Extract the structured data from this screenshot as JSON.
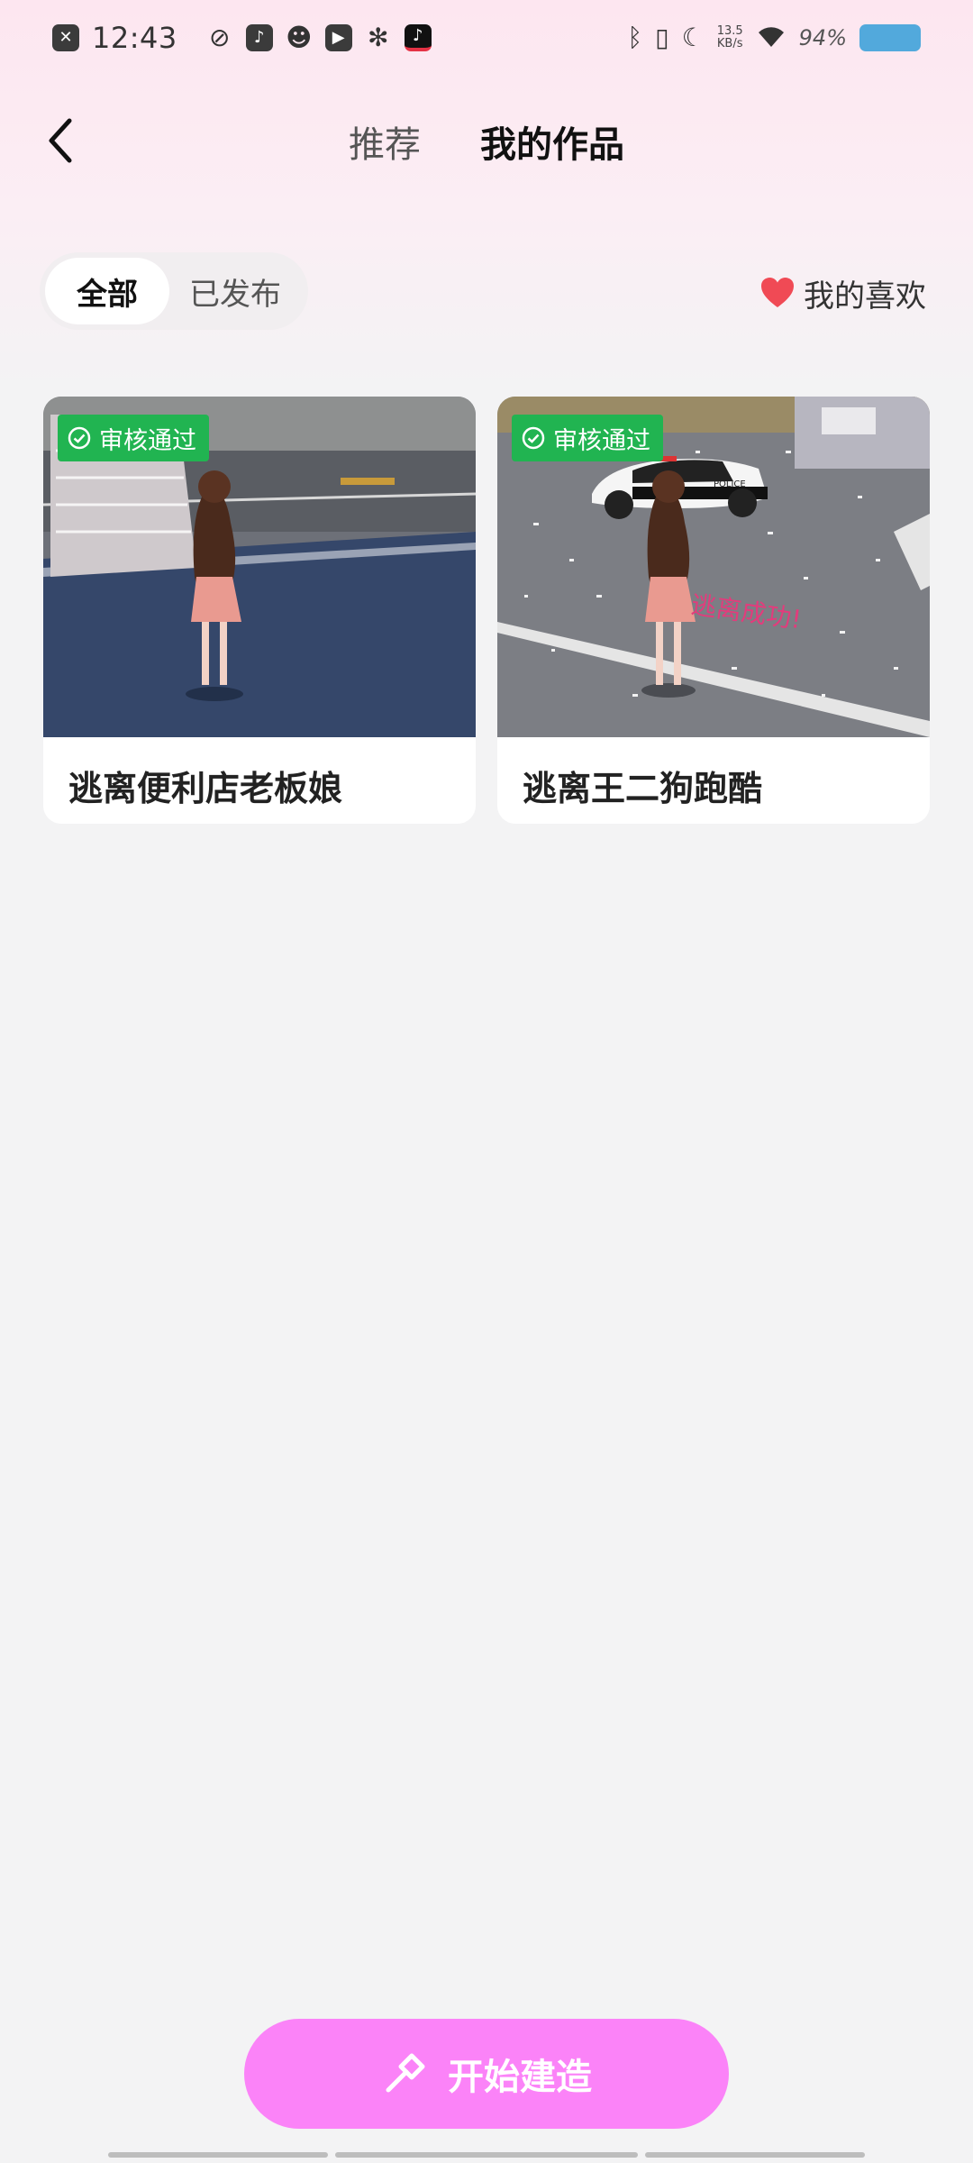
{
  "status_bar": {
    "time": "12:43",
    "net_speed_value": "13.5",
    "net_speed_unit": "KB/s",
    "battery_percent": "94%",
    "icons": [
      "close-square-icon",
      "app-icon",
      "music-icon",
      "cat-icon",
      "play-icon",
      "fan-icon",
      "tiktok-icon",
      "bluetooth-icon",
      "vibrate-icon",
      "moon-icon",
      "wifi-icon",
      "battery-icon"
    ]
  },
  "header": {
    "tabs": [
      {
        "label": "推荐",
        "active": false
      },
      {
        "label": "我的作品",
        "active": true
      }
    ]
  },
  "filters": {
    "options": [
      {
        "label": "全部",
        "active": true
      },
      {
        "label": "已发布",
        "active": false
      }
    ],
    "likes_label": "我的喜欢"
  },
  "works": [
    {
      "title": "逃离便利店老板娘",
      "badge": "审核通过"
    },
    {
      "title": "逃离王二狗跑酷",
      "badge": "审核通过",
      "overlay_text": "逃离成功!",
      "car_text": "POLICE"
    }
  ],
  "cta": {
    "label": "开始建造"
  },
  "colors": {
    "accent_pink": "#fb83f8",
    "badge_green": "#21b451",
    "heart_red": "#f04a55",
    "battery_blue": "#52a9dc"
  }
}
